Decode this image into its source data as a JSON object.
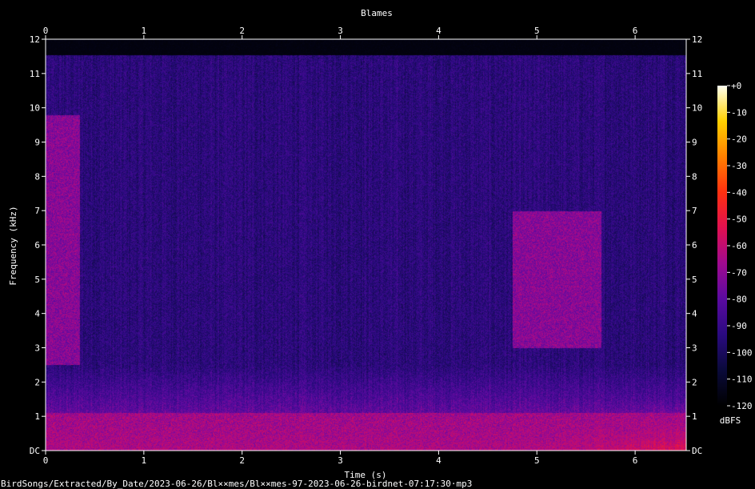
{
  "chart_data": {
    "type": "heatmap",
    "title": "Blames",
    "xlabel": "Time (s)",
    "ylabel": "Frequency (kHz)",
    "xlim": [
      0,
      6.52
    ],
    "ylim": [
      0,
      12
    ],
    "x_ticks": [
      "0",
      "1",
      "2",
      "3",
      "4",
      "5",
      "6"
    ],
    "y_ticks": [
      "DC",
      "1",
      "2",
      "3",
      "4",
      "5",
      "6",
      "7",
      "8",
      "9",
      "10",
      "11",
      "12"
    ],
    "colorbar": {
      "unit": "dBFS",
      "ticks": [
        "+0",
        "-10",
        "-20",
        "-30",
        "-40",
        "-50",
        "-60",
        "-70",
        "-80",
        "-90",
        "-100",
        "-110",
        "-120"
      ],
      "range": [
        -120,
        0
      ],
      "colors": [
        "#000000",
        "#0a0a3a",
        "#2a0a80",
        "#5a0aa0",
        "#a00a90",
        "#e01050",
        "#ff3010",
        "#ff8000",
        "#ffd000",
        "#fffff0"
      ]
    },
    "energy_regions": [
      {
        "t": [
          0.0,
          0.35
        ],
        "f": [
          2.5,
          9.8
        ],
        "dbfs": -70
      },
      {
        "t": [
          4.75,
          5.65
        ],
        "f": [
          3.0,
          7.0
        ],
        "dbfs": -70
      },
      {
        "t": [
          0.0,
          6.52
        ],
        "f": [
          0.0,
          1.1
        ],
        "dbfs": -65
      }
    ],
    "footer": "BirdSongs/Extracted/By_Date/2023-06-26/Bl××mes/Bl××mes-97-2023-06-26-birdnet-07:17:30·mp3"
  }
}
